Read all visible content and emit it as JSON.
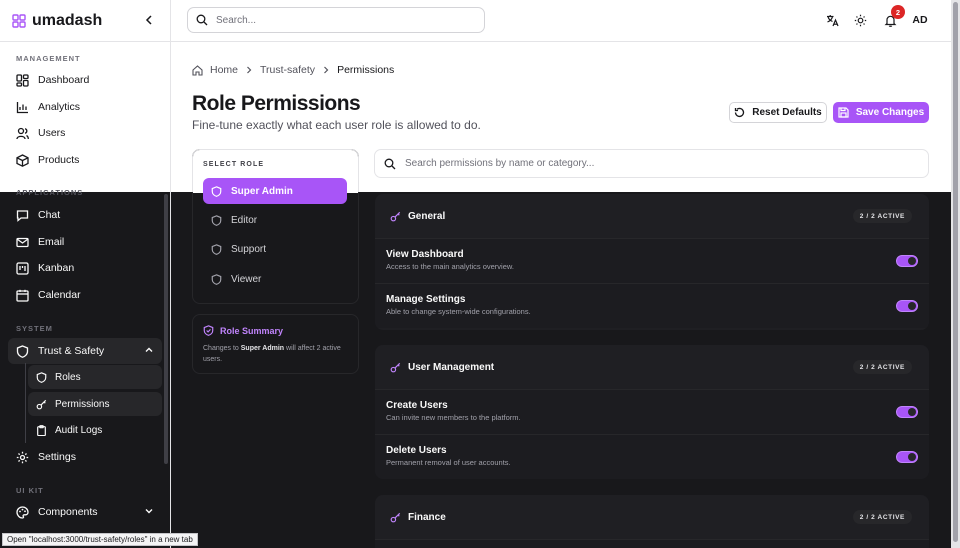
{
  "app": {
    "name": "umadash"
  },
  "colors": {
    "accent": "#a855f7",
    "dark_bg": "#18181b",
    "badge_red": "#dc2626"
  },
  "sidebar": {
    "sections": {
      "management": "MANAGEMENT",
      "applications": "APPLICATIONS",
      "system": "SYSTEM",
      "ui_kit": "UI KIT"
    },
    "management_items": [
      {
        "label": "Dashboard",
        "icon": "dashboard-icon"
      },
      {
        "label": "Analytics",
        "icon": "chart-icon"
      },
      {
        "label": "Users",
        "icon": "users-icon"
      },
      {
        "label": "Products",
        "icon": "box-icon"
      }
    ],
    "application_items": [
      {
        "label": "Chat",
        "icon": "chat-icon"
      },
      {
        "label": "Email",
        "icon": "mail-icon"
      },
      {
        "label": "Kanban",
        "icon": "kanban-icon"
      },
      {
        "label": "Calendar",
        "icon": "calendar-icon"
      }
    ],
    "trust_safety": "Trust & Safety",
    "sub_items": [
      {
        "label": "Roles",
        "icon": "shield-icon"
      },
      {
        "label": "Permissions",
        "icon": "key-icon"
      },
      {
        "label": "Audit Logs",
        "icon": "clipboard-icon"
      }
    ],
    "settings": "Settings",
    "components": "Components"
  },
  "status_bar": {
    "url_text": "Open \"localhost:3000/trust-safety/roles\" in a new tab"
  },
  "header": {
    "search_placeholder": "Search...",
    "notifications_count": "2",
    "avatar_initials": "AD"
  },
  "breadcrumb": {
    "home": "Home",
    "section": "Trust-safety",
    "current": "Permissions"
  },
  "page": {
    "title": "Role Permissions",
    "subtitle": "Fine-tune exactly what each user role is allowed to do.",
    "reset_label": "Reset Defaults",
    "save_label": "Save Changes"
  },
  "roles": {
    "label": "SELECT ROLE",
    "items": [
      "Super Admin",
      "Editor",
      "Support",
      "Viewer"
    ],
    "selected": "Super Admin"
  },
  "summary": {
    "title": "Role Summary",
    "text_prefix": "Changes to",
    "role": "Super Admin",
    "text_suffix": "will affect 2 active users."
  },
  "perm_search_placeholder": "Search permissions by name or category...",
  "groups": [
    {
      "name": "General",
      "badge": "2 / 2 ACTIVE",
      "permissions": [
        {
          "name": "View Dashboard",
          "desc": "Access to the main analytics overview.",
          "enabled": true
        },
        {
          "name": "Manage Settings",
          "desc": "Able to change system-wide configurations.",
          "enabled": true
        }
      ]
    },
    {
      "name": "User Management",
      "badge": "2 / 2 ACTIVE",
      "permissions": [
        {
          "name": "Create Users",
          "desc": "Can invite new members to the platform.",
          "enabled": true
        },
        {
          "name": "Delete Users",
          "desc": "Permanent removal of user accounts.",
          "enabled": true
        }
      ]
    },
    {
      "name": "Finance",
      "badge": "2 / 2 ACTIVE",
      "permissions": []
    }
  ]
}
